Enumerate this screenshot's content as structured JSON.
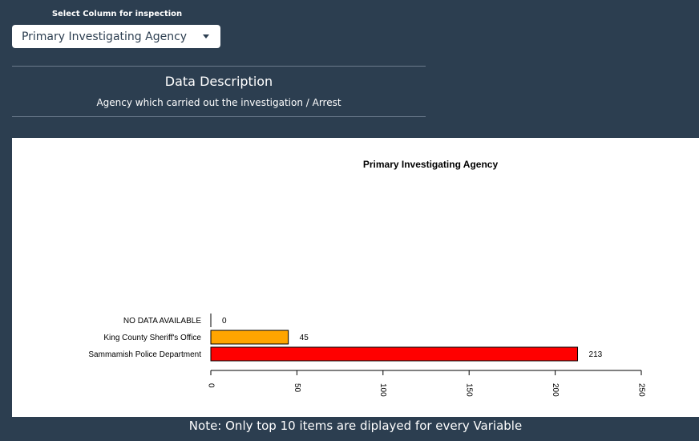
{
  "select": {
    "label": "Select Column for inspection",
    "value": "Primary Investigating Agency"
  },
  "description": {
    "title": "Data Description",
    "text": "Agency which carried out the investigation / Arrest"
  },
  "note": "Note: Only top 10 items are diplayed for every Variable",
  "chart_data": {
    "type": "bar",
    "orientation": "horizontal",
    "title": "Primary Investigating Agency",
    "categories": [
      "NO DATA AVAILABLE",
      "King County Sheriff's Office",
      "Sammamish Police Department"
    ],
    "values": [
      0,
      45,
      213
    ],
    "bar_colors": [
      "#ffa500",
      "#ffa500",
      "#ff0000"
    ],
    "xlim": [
      0,
      250
    ],
    "xticks": [
      0,
      50,
      100,
      150,
      200,
      250
    ],
    "grid": false
  }
}
